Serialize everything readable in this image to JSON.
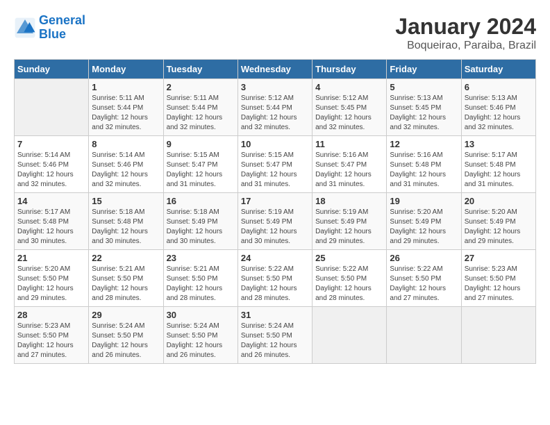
{
  "header": {
    "logo_line1": "General",
    "logo_line2": "Blue",
    "title": "January 2024",
    "subtitle": "Boqueirao, Paraiba, Brazil"
  },
  "calendar": {
    "days_of_week": [
      "Sunday",
      "Monday",
      "Tuesday",
      "Wednesday",
      "Thursday",
      "Friday",
      "Saturday"
    ],
    "weeks": [
      [
        {
          "day": "",
          "info": ""
        },
        {
          "day": "1",
          "info": "Sunrise: 5:11 AM\nSunset: 5:44 PM\nDaylight: 12 hours\nand 32 minutes."
        },
        {
          "day": "2",
          "info": "Sunrise: 5:11 AM\nSunset: 5:44 PM\nDaylight: 12 hours\nand 32 minutes."
        },
        {
          "day": "3",
          "info": "Sunrise: 5:12 AM\nSunset: 5:44 PM\nDaylight: 12 hours\nand 32 minutes."
        },
        {
          "day": "4",
          "info": "Sunrise: 5:12 AM\nSunset: 5:45 PM\nDaylight: 12 hours\nand 32 minutes."
        },
        {
          "day": "5",
          "info": "Sunrise: 5:13 AM\nSunset: 5:45 PM\nDaylight: 12 hours\nand 32 minutes."
        },
        {
          "day": "6",
          "info": "Sunrise: 5:13 AM\nSunset: 5:46 PM\nDaylight: 12 hours\nand 32 minutes."
        }
      ],
      [
        {
          "day": "7",
          "info": "Sunrise: 5:14 AM\nSunset: 5:46 PM\nDaylight: 12 hours\nand 32 minutes."
        },
        {
          "day": "8",
          "info": "Sunrise: 5:14 AM\nSunset: 5:46 PM\nDaylight: 12 hours\nand 32 minutes."
        },
        {
          "day": "9",
          "info": "Sunrise: 5:15 AM\nSunset: 5:47 PM\nDaylight: 12 hours\nand 31 minutes."
        },
        {
          "day": "10",
          "info": "Sunrise: 5:15 AM\nSunset: 5:47 PM\nDaylight: 12 hours\nand 31 minutes."
        },
        {
          "day": "11",
          "info": "Sunrise: 5:16 AM\nSunset: 5:47 PM\nDaylight: 12 hours\nand 31 minutes."
        },
        {
          "day": "12",
          "info": "Sunrise: 5:16 AM\nSunset: 5:48 PM\nDaylight: 12 hours\nand 31 minutes."
        },
        {
          "day": "13",
          "info": "Sunrise: 5:17 AM\nSunset: 5:48 PM\nDaylight: 12 hours\nand 31 minutes."
        }
      ],
      [
        {
          "day": "14",
          "info": "Sunrise: 5:17 AM\nSunset: 5:48 PM\nDaylight: 12 hours\nand 30 minutes."
        },
        {
          "day": "15",
          "info": "Sunrise: 5:18 AM\nSunset: 5:48 PM\nDaylight: 12 hours\nand 30 minutes."
        },
        {
          "day": "16",
          "info": "Sunrise: 5:18 AM\nSunset: 5:49 PM\nDaylight: 12 hours\nand 30 minutes."
        },
        {
          "day": "17",
          "info": "Sunrise: 5:19 AM\nSunset: 5:49 PM\nDaylight: 12 hours\nand 30 minutes."
        },
        {
          "day": "18",
          "info": "Sunrise: 5:19 AM\nSunset: 5:49 PM\nDaylight: 12 hours\nand 29 minutes."
        },
        {
          "day": "19",
          "info": "Sunrise: 5:20 AM\nSunset: 5:49 PM\nDaylight: 12 hours\nand 29 minutes."
        },
        {
          "day": "20",
          "info": "Sunrise: 5:20 AM\nSunset: 5:49 PM\nDaylight: 12 hours\nand 29 minutes."
        }
      ],
      [
        {
          "day": "21",
          "info": "Sunrise: 5:20 AM\nSunset: 5:50 PM\nDaylight: 12 hours\nand 29 minutes."
        },
        {
          "day": "22",
          "info": "Sunrise: 5:21 AM\nSunset: 5:50 PM\nDaylight: 12 hours\nand 28 minutes."
        },
        {
          "day": "23",
          "info": "Sunrise: 5:21 AM\nSunset: 5:50 PM\nDaylight: 12 hours\nand 28 minutes."
        },
        {
          "day": "24",
          "info": "Sunrise: 5:22 AM\nSunset: 5:50 PM\nDaylight: 12 hours\nand 28 minutes."
        },
        {
          "day": "25",
          "info": "Sunrise: 5:22 AM\nSunset: 5:50 PM\nDaylight: 12 hours\nand 28 minutes."
        },
        {
          "day": "26",
          "info": "Sunrise: 5:22 AM\nSunset: 5:50 PM\nDaylight: 12 hours\nand 27 minutes."
        },
        {
          "day": "27",
          "info": "Sunrise: 5:23 AM\nSunset: 5:50 PM\nDaylight: 12 hours\nand 27 minutes."
        }
      ],
      [
        {
          "day": "28",
          "info": "Sunrise: 5:23 AM\nSunset: 5:50 PM\nDaylight: 12 hours\nand 27 minutes."
        },
        {
          "day": "29",
          "info": "Sunrise: 5:24 AM\nSunset: 5:50 PM\nDaylight: 12 hours\nand 26 minutes."
        },
        {
          "day": "30",
          "info": "Sunrise: 5:24 AM\nSunset: 5:50 PM\nDaylight: 12 hours\nand 26 minutes."
        },
        {
          "day": "31",
          "info": "Sunrise: 5:24 AM\nSunset: 5:50 PM\nDaylight: 12 hours\nand 26 minutes."
        },
        {
          "day": "",
          "info": ""
        },
        {
          "day": "",
          "info": ""
        },
        {
          "day": "",
          "info": ""
        }
      ]
    ]
  }
}
